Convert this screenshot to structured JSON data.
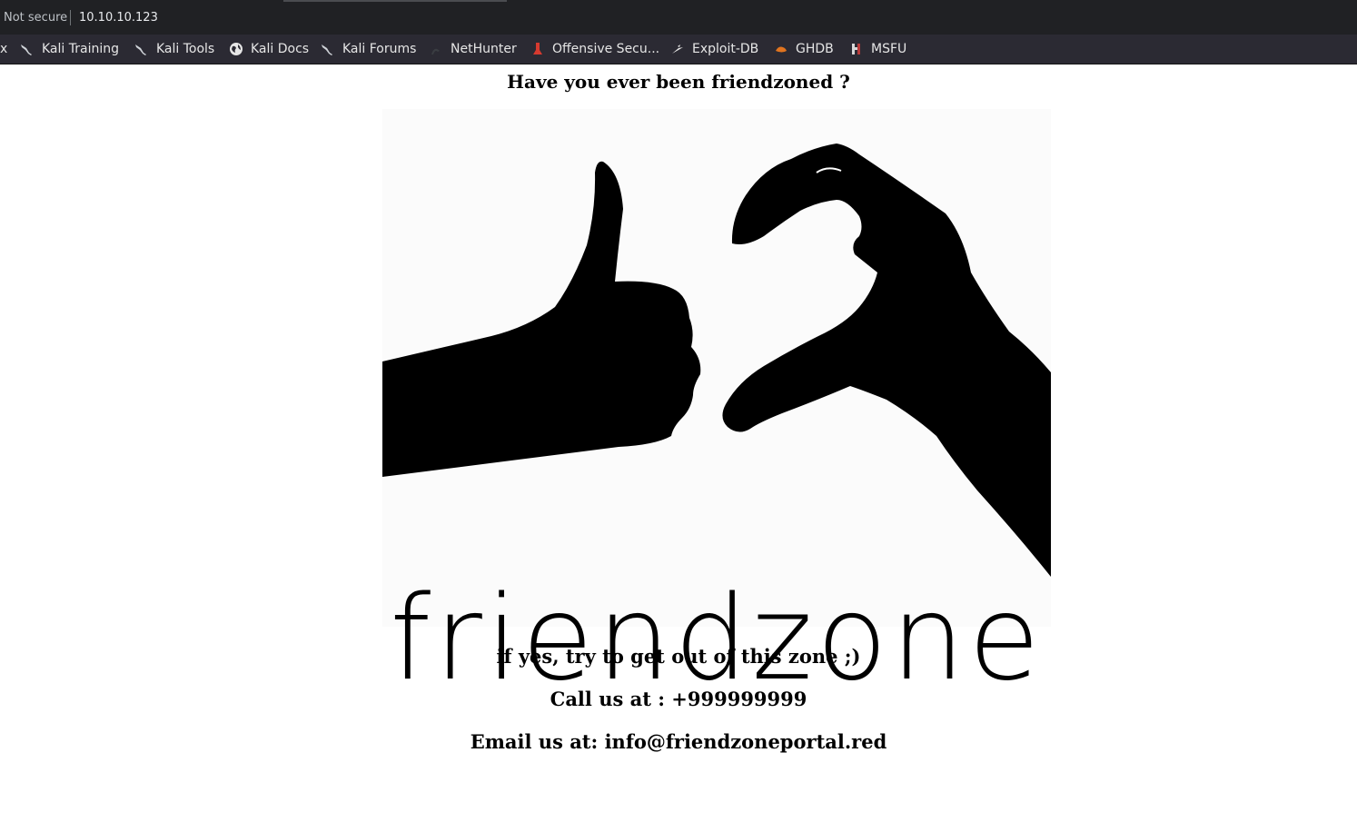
{
  "browser": {
    "security_label": "Not secure",
    "url": "10.10.10.123",
    "bookmarks": [
      {
        "label": "x",
        "icon": "bookmark-fragment-icon"
      },
      {
        "label": "Kali Training",
        "icon": "kali-dragon-icon"
      },
      {
        "label": "Kali Tools",
        "icon": "kali-dragon-icon"
      },
      {
        "label": "Kali Docs",
        "icon": "globe-icon"
      },
      {
        "label": "Kali Forums",
        "icon": "kali-dragon-icon"
      },
      {
        "label": "NetHunter",
        "icon": "nethunter-icon"
      },
      {
        "label": "Offensive Secu...",
        "icon": "offsec-icon"
      },
      {
        "label": "Exploit-DB",
        "icon": "exploit-db-icon"
      },
      {
        "label": "GHDB",
        "icon": "ghdb-icon"
      },
      {
        "label": "MSFU",
        "icon": "msfu-icon"
      }
    ]
  },
  "page": {
    "headline": "Have you ever been friendzoned ?",
    "hero_logo_text": "friendzone",
    "line1": "if yes, try to get out of this zone ;)",
    "line2": "Call us at : +999999999",
    "line3": "Email us at: info@friendzoneportal.red"
  },
  "colors": {
    "urlbar_bg": "#202124",
    "bookmarks_bg": "#2b2a33",
    "page_bg": "#ffffff",
    "text": "#000000"
  }
}
